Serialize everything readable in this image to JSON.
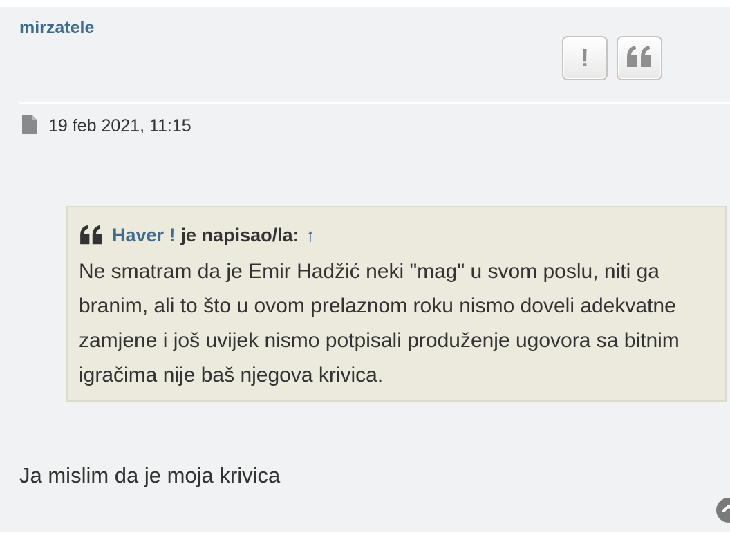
{
  "post": {
    "author": "mirzatele",
    "date": "19 feb 2021, 11:15",
    "buttons": {
      "report_glyph": "!",
      "quote_icon": "quote-icon"
    },
    "quote": {
      "author": "Haver !",
      "wrote_label": "je napisao/la:",
      "arrow": "↑",
      "text": "Ne smatram da je Emir Hadžić neki \"mag\" u svom poslu, niti ga branim, ali to što u ovom prelaznom roku nismo doveli adekvatne zamjene i još uvijek nismo potpisali produženje ugovora sa bitnim igračima nije baš njegova krivica."
    },
    "body_text": "Ja mislim da je moja krivica"
  },
  "colors": {
    "post_bg": "#f1f2f3",
    "quote_bg": "#ebeadd",
    "link": "#3f6b8f",
    "text": "#333333"
  }
}
